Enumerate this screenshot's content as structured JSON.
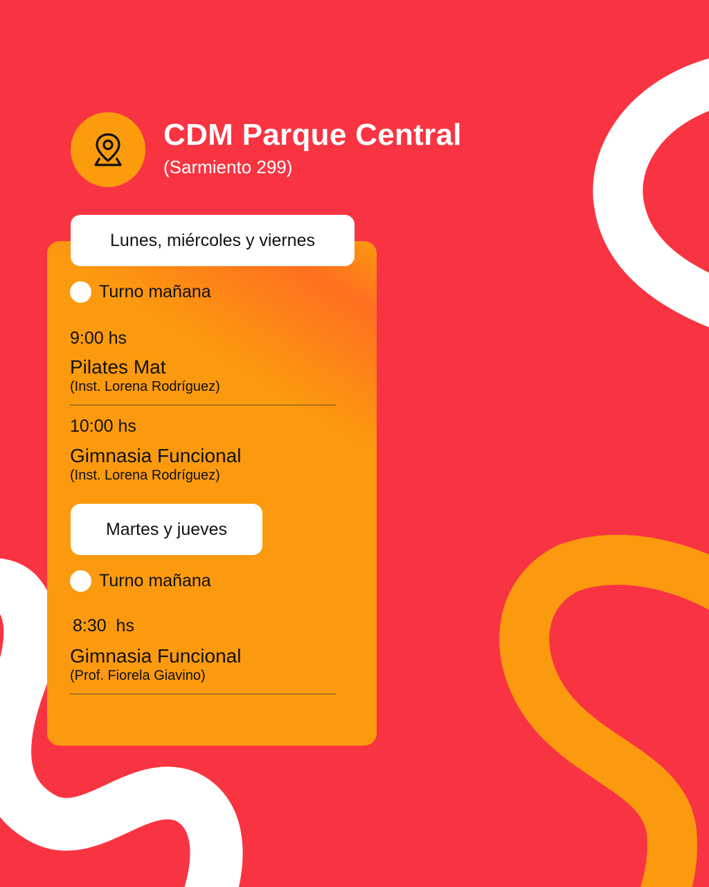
{
  "header": {
    "icon": "location-pin-icon",
    "title": "CDM Parque Central",
    "subtitle": "(Sarmiento 299)"
  },
  "colors": {
    "background": "#f93442",
    "accent_orange": "#fb9a0e",
    "white": "#ffffff",
    "text": "#111111"
  },
  "schedule": {
    "groups": [
      {
        "days": "Lunes, miércoles y viernes",
        "shift": "Turno mañana",
        "classes": [
          {
            "time": "9:00 hs",
            "name": "Pilates Mat",
            "instructor": "(Inst. Lorena Rodríguez)"
          },
          {
            "time": "10:00 hs",
            "name": "Gimnasia Funcional",
            "instructor": "(Inst. Lorena Rodríguez)"
          }
        ]
      },
      {
        "days": "Martes y jueves",
        "shift": "Turno mañana",
        "classes": [
          {
            "time": "8:30  hs",
            "name": "Gimnasia Funcional",
            "instructor": "(Prof. Fiorela Giavino)"
          }
        ]
      }
    ]
  }
}
